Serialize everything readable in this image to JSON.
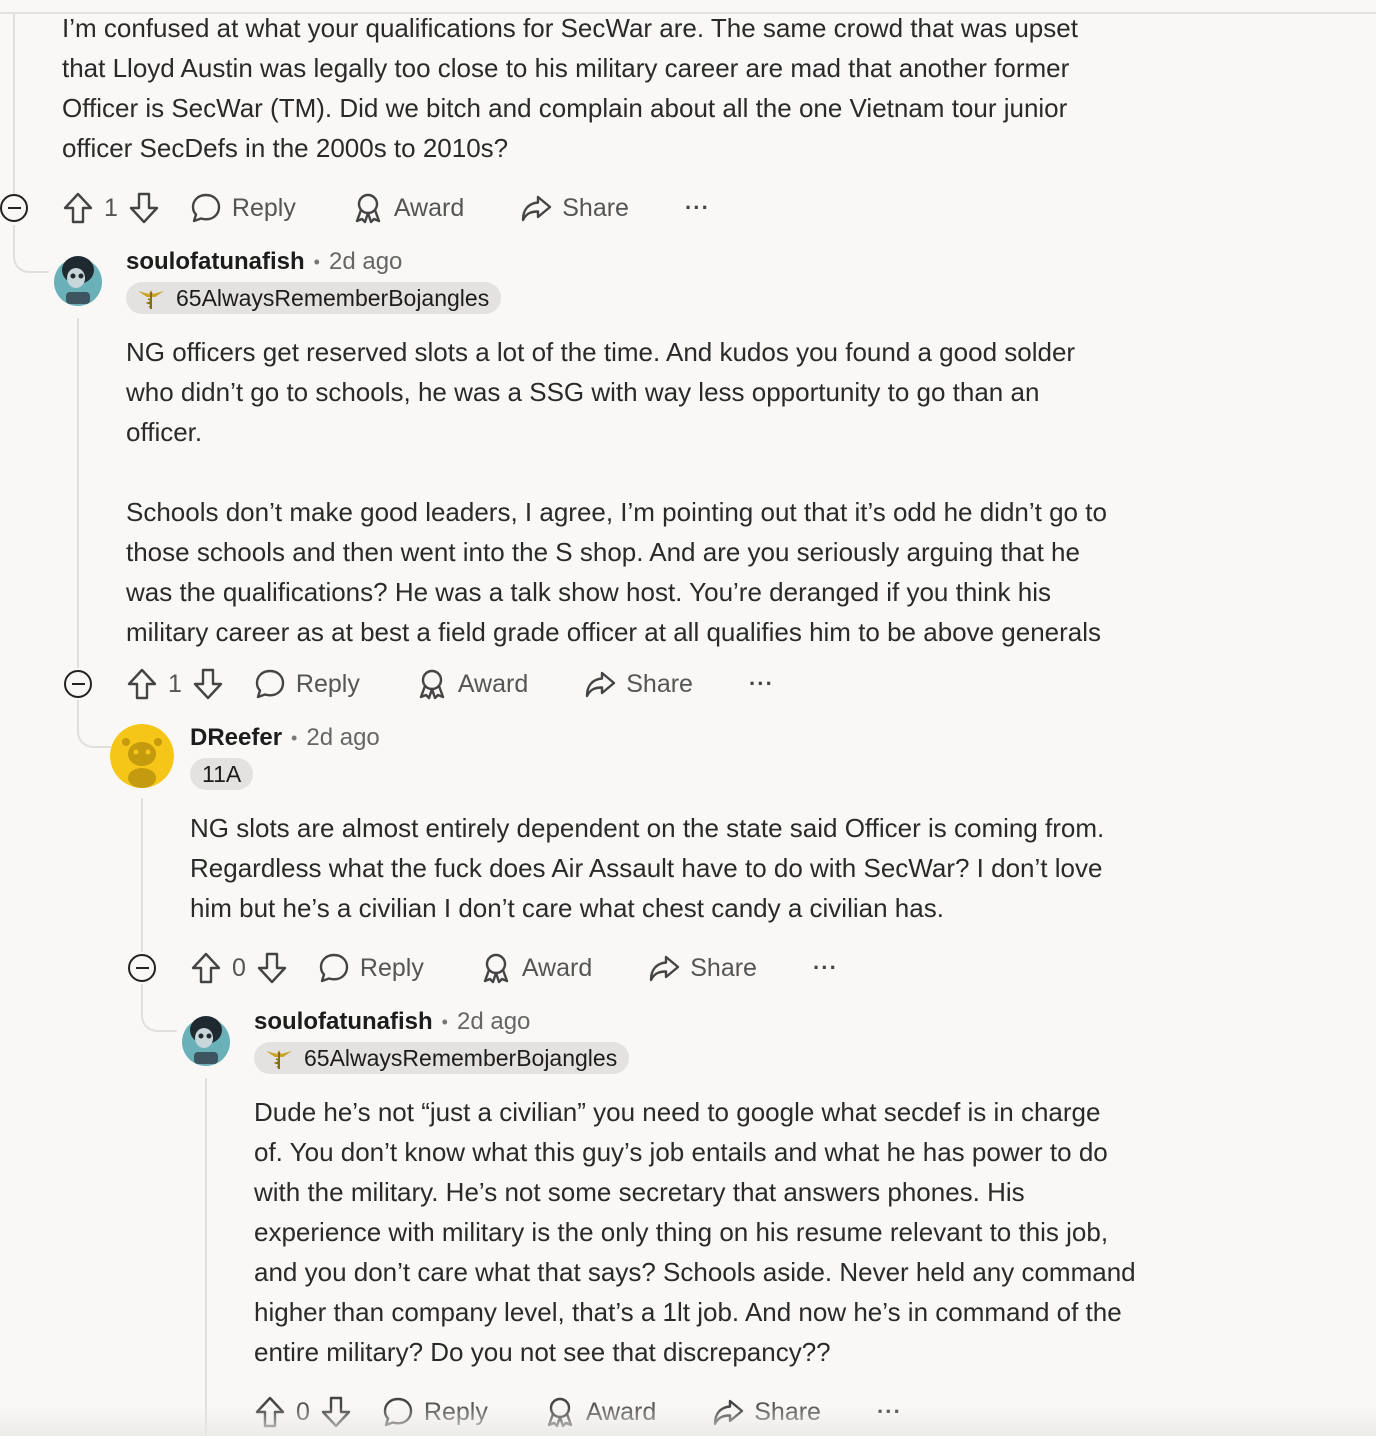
{
  "comments": [
    {
      "body": "I’m confused at what your qualifications for SecWar are. The same crowd that was upset\nthat Lloyd Austin was legally too close to his military career are mad that another former\nOfficer is SecWar (TM). Did we bitch and complain about all the one Vietnam tour junior\nofficer SecDefs in the 2000s to 2010s?",
      "votes": "1"
    },
    {
      "author": "soulofatunafish",
      "time": "2d ago",
      "flair": "65AlwaysRememberBojangles",
      "body": "NG officers get reserved slots a lot of the time. And kudos you found a good solder\nwho didn’t go to schools, he was a SSG with way less opportunity to go than an\nofficer.\n\nSchools don’t make good leaders, I agree, I’m pointing out that it’s odd he didn’t go to\nthose schools and then went into the S shop. And are you seriously arguing that he\nwas the qualifications? He was a talk show host. You’re deranged if you think his\nmilitary career as at best a field grade officer at all qualifies him to be above generals",
      "votes": "1"
    },
    {
      "author": "DReefer",
      "time": "2d ago",
      "flair": "11A",
      "body": "NG slots are almost entirely dependent on the state said Officer is coming from.\nRegardless what the fuck does Air Assault have to do with SecWar? I don’t love\nhim but he’s a civilian I don’t care what chest candy a civilian has.",
      "votes": "0"
    },
    {
      "author": "soulofatunafish",
      "time": "2d ago",
      "flair": "65AlwaysRememberBojangles",
      "body": "Dude he’s not “just a civilian” you need to google what secdef is in charge\nof. You don’t know what this guy’s job entails and what he has power to do\nwith the military. He’s not some secretary that answers phones. His\nexperience with military is the only thing on his resume relevant to this job,\nand you don’t care what that says? Schools aside. Never held any command\nhigher than company level, that’s a 1lt job. And now he’s in command of the\nentire military? Do you not see that discrepancy??",
      "votes": "0"
    }
  ],
  "actions": {
    "reply": "Reply",
    "award": "Award",
    "share": "Share",
    "more": "···"
  },
  "header_separator": "•",
  "icons": {
    "upvote": "upvote-arrow-icon",
    "downvote": "downvote-arrow-icon",
    "reply": "speech-bubble-icon",
    "award": "award-ribbon-icon",
    "share": "share-arrow-icon",
    "collapse": "collapse-minus-icon",
    "flair": "caduceus-icon"
  },
  "colors": {
    "background": "#f9f8f6",
    "text": "#2a2a2a",
    "muted": "#555555",
    "flair_bg": "#e3e2e0",
    "thread_line": "#e1dfdb",
    "dreefer_avatar": "#f5c518"
  }
}
